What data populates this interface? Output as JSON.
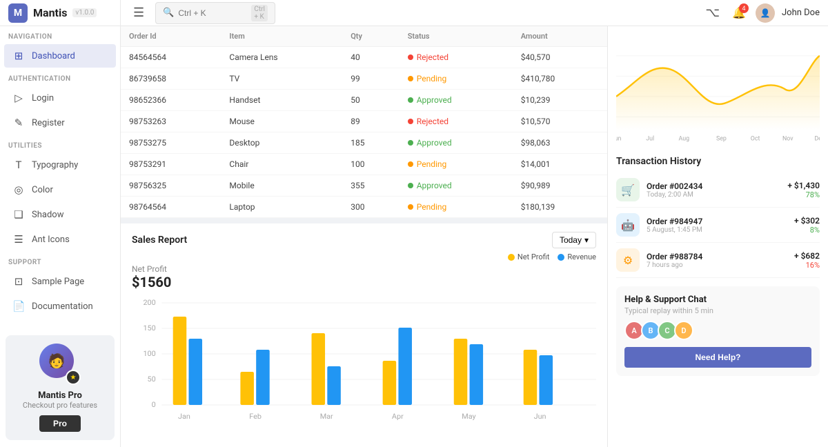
{
  "brand": {
    "name": "Mantis",
    "version": "v1.0.0",
    "icon_letter": "M"
  },
  "topbar": {
    "search_placeholder": "Ctrl + K",
    "username": "John Doe",
    "notification_count": "4"
  },
  "sidebar": {
    "nav_label": "Navigation",
    "auth_label": "Authentication",
    "utilities_label": "Utilities",
    "support_label": "Support",
    "nav_items": [
      {
        "id": "dashboard",
        "label": "Dashboard",
        "icon": "⊞",
        "active": true
      }
    ],
    "auth_items": [
      {
        "id": "login",
        "label": "Login",
        "icon": "◻"
      },
      {
        "id": "register",
        "label": "Register",
        "icon": "◻"
      }
    ],
    "utilities_items": [
      {
        "id": "typography",
        "label": "Typography",
        "icon": "T"
      },
      {
        "id": "color",
        "label": "Color",
        "icon": "◎"
      },
      {
        "id": "shadow",
        "label": "Shadow",
        "icon": "◻"
      },
      {
        "id": "ant-icons",
        "label": "Ant Icons",
        "icon": "◻"
      }
    ],
    "support_items": [
      {
        "id": "sample-page",
        "label": "Sample Page",
        "icon": "◻"
      },
      {
        "id": "documentation",
        "label": "Documentation",
        "icon": "◻"
      }
    ]
  },
  "pro_card": {
    "title": "Mantis Pro",
    "subtitle": "Checkout pro features",
    "button_label": "Pro"
  },
  "orders_table": {
    "columns": [
      "Order Id",
      "Item",
      "Qty",
      "Status",
      "Amount"
    ],
    "rows": [
      {
        "id": "84564564",
        "item": "Camera Lens",
        "qty": 40,
        "status": "Rejected",
        "amount": "$40,570"
      },
      {
        "id": "86739658",
        "item": "TV",
        "qty": 99,
        "status": "Pending",
        "amount": "$410,780"
      },
      {
        "id": "98652366",
        "item": "Handset",
        "qty": 50,
        "status": "Approved",
        "amount": "$10,239"
      },
      {
        "id": "98753263",
        "item": "Mouse",
        "qty": 89,
        "status": "Rejected",
        "amount": "$10,570"
      },
      {
        "id": "98753275",
        "item": "Desktop",
        "qty": 185,
        "status": "Approved",
        "amount": "$98,063"
      },
      {
        "id": "98753291",
        "item": "Chair",
        "qty": 100,
        "status": "Pending",
        "amount": "$14,001"
      },
      {
        "id": "98756325",
        "item": "Mobile",
        "qty": 355,
        "status": "Approved",
        "amount": "$90,989"
      },
      {
        "id": "98764564",
        "item": "Laptop",
        "qty": 300,
        "status": "Pending",
        "amount": "$180,139"
      }
    ]
  },
  "right_panel": {
    "line_chart": {
      "months": [
        "Jun",
        "Jul",
        "Aug",
        "Sep",
        "Oct",
        "Nov",
        "Dec"
      ]
    },
    "transaction_title": "Transaction History",
    "transactions": [
      {
        "id": "Order #002434",
        "time": "Today, 2:00 AM",
        "amount": "+ $1,430",
        "pct": "78%",
        "pct_positive": true,
        "icon": "🛒"
      },
      {
        "id": "Order #984947",
        "time": "5 August, 1:45 PM",
        "amount": "+ $302",
        "pct": "8%",
        "pct_positive": true,
        "icon": "🤖"
      },
      {
        "id": "Order #988784",
        "time": "7 hours ago",
        "amount": "+ $682",
        "pct": "16%",
        "pct_positive": false,
        "icon": "⚙"
      }
    ],
    "help_title": "Help & Support Chat",
    "help_subtitle": "Typical replay within 5 min",
    "help_button": "Need Help?"
  },
  "sales_report": {
    "title": "Sales Report",
    "filter_label": "Today",
    "net_profit_label": "Net Profit",
    "net_profit_value": "$1560",
    "legend_net_profit": "Net Profit",
    "legend_revenue": "Revenue",
    "months": [
      "Jan",
      "Feb",
      "Mar",
      "Apr",
      "May",
      "Jun"
    ],
    "bar_data_orange": [
      160,
      60,
      130,
      80,
      120,
      100
    ],
    "bar_data_blue": [
      120,
      100,
      70,
      140,
      110,
      90
    ],
    "y_axis": [
      200,
      150,
      100,
      50,
      0
    ]
  }
}
